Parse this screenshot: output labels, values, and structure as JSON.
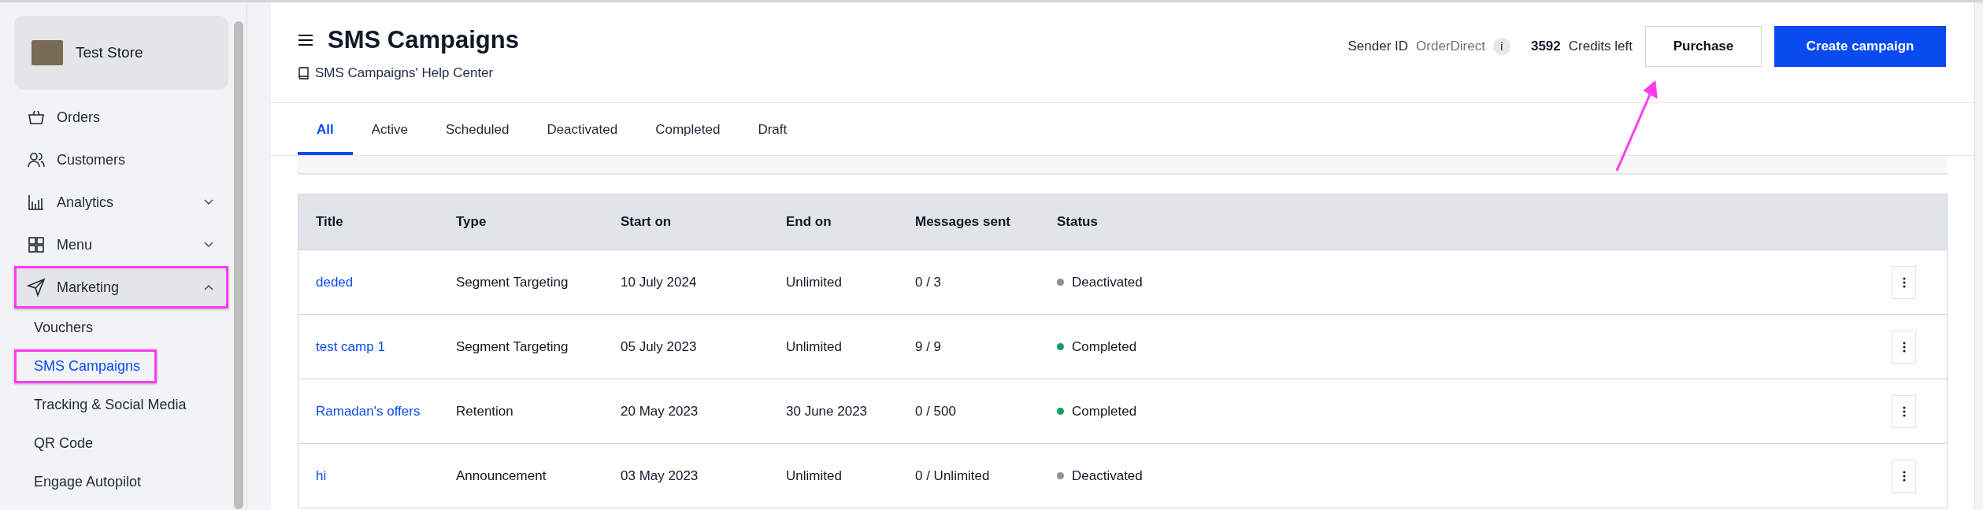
{
  "sidebar": {
    "store": {
      "name": "Test Store"
    },
    "items": [
      {
        "label": "Orders",
        "selected": false,
        "highlighted": false
      },
      {
        "label": "Customers",
        "selected": false,
        "highlighted": false
      },
      {
        "label": "Analytics",
        "selected": false,
        "highlighted": false,
        "expanded": false
      },
      {
        "label": "Menu",
        "selected": false,
        "highlighted": false,
        "expanded": false
      },
      {
        "label": "Marketing",
        "selected": true,
        "highlighted": true,
        "expanded": true,
        "children": [
          {
            "label": "Vouchers",
            "selected": false,
            "highlighted": false
          },
          {
            "label": "SMS Campaigns",
            "selected": true,
            "highlighted": true
          },
          {
            "label": "Tracking & Social Media",
            "selected": false,
            "highlighted": false
          },
          {
            "label": "QR Code",
            "selected": false,
            "highlighted": false
          },
          {
            "label": "Engage Autopilot",
            "selected": false,
            "highlighted": false
          }
        ]
      }
    ]
  },
  "header": {
    "title": "SMS Campaigns",
    "help_link": "SMS Campaigns' Help Center",
    "sender_label": "Sender ID",
    "sender_value": "OrderDirect",
    "info": "i",
    "credits": "3592",
    "credits_label": "Credits left",
    "buttons": [
      {
        "label": "Purchase",
        "kind": "secondary",
        "pointed_at": true
      },
      {
        "label": "Create campaign",
        "kind": "primary"
      }
    ]
  },
  "tabs": [
    {
      "label": "All",
      "selected": true
    },
    {
      "label": "Active",
      "selected": false
    },
    {
      "label": "Scheduled",
      "selected": false
    },
    {
      "label": "Deactivated",
      "selected": false
    },
    {
      "label": "Completed",
      "selected": false
    },
    {
      "label": "Draft",
      "selected": false
    }
  ],
  "table": {
    "columns": [
      "Title",
      "Type",
      "Start on",
      "End on",
      "Messages sent",
      "Status"
    ],
    "rows": [
      {
        "title": "deded",
        "type": "Segment Targeting",
        "start_on": "10 July 2024",
        "end_on": "Unlimited",
        "messages_sent": "0 / 3",
        "status": "Deactivated",
        "color": "#8a8f98"
      },
      {
        "title": "test camp 1",
        "type": "Segment Targeting",
        "start_on": "05 July 2023",
        "end_on": "Unlimited",
        "messages_sent": "9 / 9",
        "status": "Completed",
        "color": "#12a05c"
      },
      {
        "title": "Ramadan's offers",
        "type": "Retention",
        "start_on": "20 May 2023",
        "end_on": "30 June 2023",
        "messages_sent": "0 / 500",
        "status": "Completed",
        "color": "#12a05c"
      },
      {
        "title": "hi",
        "type": "Announcement",
        "start_on": "03 May 2023",
        "end_on": "Unlimited",
        "messages_sent": "0 / Unlimited",
        "status": "Deactivated",
        "color": "#8a8f98"
      }
    ]
  }
}
